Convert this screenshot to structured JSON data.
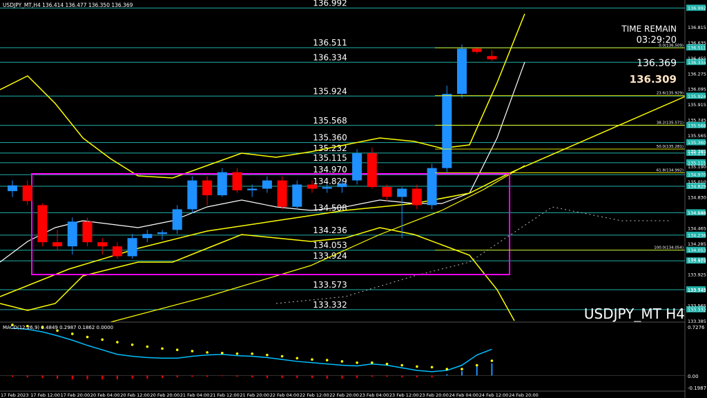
{
  "header": {
    "symbol_line": "USDJPY_MT,H4  136.414 136.477 136.350 136.369",
    "time_remain_label": "TIME REMAIN",
    "time_remain_value": "03:29:20",
    "bid": "136.369",
    "ask": "136.309",
    "watermark": "USDJPY_MT H4"
  },
  "colors": {
    "background": "#000000",
    "bull": "#1E90FF",
    "bear": "#FF0000",
    "level_line": "#20B2AA",
    "band": "#FFFF00",
    "box": "#FF00FF",
    "macd_line": "#00BFFF",
    "macd_signal": "#FFFF00"
  },
  "levels": [
    {
      "value": 136.992,
      "label": "136.992"
    },
    {
      "value": 136.511,
      "label": "136.511"
    },
    {
      "value": 136.334,
      "label": "136.334"
    },
    {
      "value": 135.924,
      "label": "135.924"
    },
    {
      "value": 135.568,
      "label": "135.568"
    },
    {
      "value": 135.36,
      "label": "135.360"
    },
    {
      "value": 135.232,
      "label": "135.232"
    },
    {
      "value": 135.115,
      "label": "135.115"
    },
    {
      "value": 134.97,
      "label": "134.970"
    },
    {
      "value": 134.829,
      "label": "134.829"
    },
    {
      "value": 134.508,
      "label": "134.508"
    },
    {
      "value": 134.236,
      "label": "134.236"
    },
    {
      "value": 134.053,
      "label": "134.053"
    },
    {
      "value": 133.924,
      "label": "133.924"
    },
    {
      "value": 133.573,
      "label": "133.573"
    },
    {
      "value": 133.332,
      "label": "133.332"
    }
  ],
  "price_axis": {
    "ticks": [
      "136.815",
      "136.635",
      "136.455",
      "136.275",
      "136.095",
      "135.915",
      "135.745",
      "135.565",
      "135.385",
      "135.190",
      "135.010",
      "134.830",
      "134.645",
      "134.465",
      "134.285",
      "134.105",
      "133.925",
      "133.745",
      "133.565",
      "133.385"
    ],
    "label_min": 133.385,
    "label_max": 136.815
  },
  "fib_labels": [
    {
      "value": 136.509,
      "label": "0.0(136.509)"
    },
    {
      "value": 135.929,
      "label": "23.6(135.929)"
    },
    {
      "value": 135.571,
      "label": "38.2(135.571)"
    },
    {
      "value": 135.281,
      "label": "50.0(135.281)"
    },
    {
      "value": 134.992,
      "label": "61.8(134.992)"
    },
    {
      "value": 134.054,
      "label": "100.0(134.054)"
    }
  ],
  "candles": [
    [
      134.77,
      134.9,
      134.7,
      134.84
    ],
    [
      134.84,
      134.9,
      134.6,
      134.65
    ],
    [
      134.6,
      134.62,
      134.1,
      134.15
    ],
    [
      134.15,
      134.3,
      134.05,
      134.1
    ],
    [
      134.1,
      134.45,
      134.0,
      134.4
    ],
    [
      134.4,
      134.45,
      134.1,
      134.15
    ],
    [
      134.15,
      134.2,
      134.0,
      134.1
    ],
    [
      134.1,
      134.15,
      133.95,
      133.98
    ],
    [
      133.98,
      134.25,
      133.95,
      134.2
    ],
    [
      134.2,
      134.3,
      134.15,
      134.25
    ],
    [
      134.25,
      134.3,
      134.18,
      134.27
    ],
    [
      134.3,
      134.6,
      134.25,
      134.55
    ],
    [
      134.55,
      134.95,
      134.5,
      134.9
    ],
    [
      134.9,
      134.95,
      134.6,
      134.72
    ],
    [
      134.72,
      135.05,
      134.7,
      135.0
    ],
    [
      135.0,
      135.05,
      134.75,
      134.78
    ],
    [
      134.78,
      134.85,
      134.7,
      134.8
    ],
    [
      134.8,
      134.95,
      134.75,
      134.9
    ],
    [
      134.9,
      134.95,
      134.55,
      134.58
    ],
    [
      134.58,
      134.9,
      134.55,
      134.85
    ],
    [
      134.85,
      134.9,
      134.75,
      134.8
    ],
    [
      134.8,
      134.85,
      134.75,
      134.82
    ],
    [
      134.82,
      134.9,
      134.75,
      134.86
    ],
    [
      134.9,
      135.28,
      134.85,
      135.23
    ],
    [
      135.23,
      135.3,
      134.8,
      134.82
    ],
    [
      134.82,
      134.85,
      134.65,
      134.7
    ],
    [
      134.7,
      134.82,
      134.2,
      134.8
    ],
    [
      134.8,
      134.85,
      134.55,
      134.6
    ],
    [
      134.6,
      135.1,
      134.55,
      135.05
    ],
    [
      135.05,
      136.05,
      135.0,
      135.95
    ],
    [
      135.95,
      136.55,
      135.9,
      136.5
    ],
    [
      136.5,
      136.52,
      136.44,
      136.46
    ],
    [
      136.41,
      136.48,
      136.35,
      136.37
    ]
  ],
  "macd": {
    "label": "MACD(12,26,9) 0.4849 0.2987 0.1862 0.0000",
    "top_tick": "0.7276",
    "zero_tick": "0.00",
    "bottom_tick": "-0.1987",
    "line": [
      0.74,
      0.72,
      0.68,
      0.62,
      0.55,
      0.47,
      0.4,
      0.33,
      0.3,
      0.28,
      0.27,
      0.27,
      0.3,
      0.32,
      0.33,
      0.31,
      0.3,
      0.28,
      0.25,
      0.22,
      0.2,
      0.18,
      0.16,
      0.15,
      0.18,
      0.16,
      0.12,
      0.08,
      0.06,
      0.08,
      0.16,
      0.32,
      0.41
    ],
    "signal": [
      0.79,
      0.77,
      0.75,
      0.7,
      0.65,
      0.6,
      0.56,
      0.52,
      0.48,
      0.45,
      0.42,
      0.4,
      0.38,
      0.36,
      0.35,
      0.34,
      0.34,
      0.32,
      0.3,
      0.27,
      0.25,
      0.24,
      0.22,
      0.2,
      0.2,
      0.18,
      0.16,
      0.14,
      0.13,
      0.1,
      0.1,
      0.16,
      0.23
    ],
    "hist": [
      -0.02,
      -0.03,
      -0.04,
      -0.05,
      -0.06,
      -0.06,
      -0.06,
      -0.06,
      -0.05,
      -0.05,
      -0.04,
      -0.03,
      -0.02,
      -0.02,
      -0.01,
      -0.02,
      -0.03,
      -0.04,
      -0.04,
      -0.04,
      -0.04,
      -0.05,
      -0.05,
      -0.04,
      -0.02,
      -0.02,
      -0.03,
      -0.03,
      -0.03,
      0.02,
      0.07,
      0.17,
      0.19
    ]
  },
  "time_labels": [
    "17 Feb 2023",
    "17 Feb 12:00",
    "17 Feb 20:00",
    "20 Feb 04:00",
    "20 Feb 12:00",
    "20 Feb 20:00",
    "21 Feb 04:00",
    "21 Feb 12:00",
    "21 Feb 20:00",
    "22 Feb 04:00",
    "22 Feb 12:00",
    "22 Feb 20:00",
    "23 Feb 04:00",
    "23 Feb 12:00",
    "23 Feb 20:00",
    "24 Feb 04:00",
    "24 Feb 12:00",
    "24 Feb 20:00"
  ]
}
